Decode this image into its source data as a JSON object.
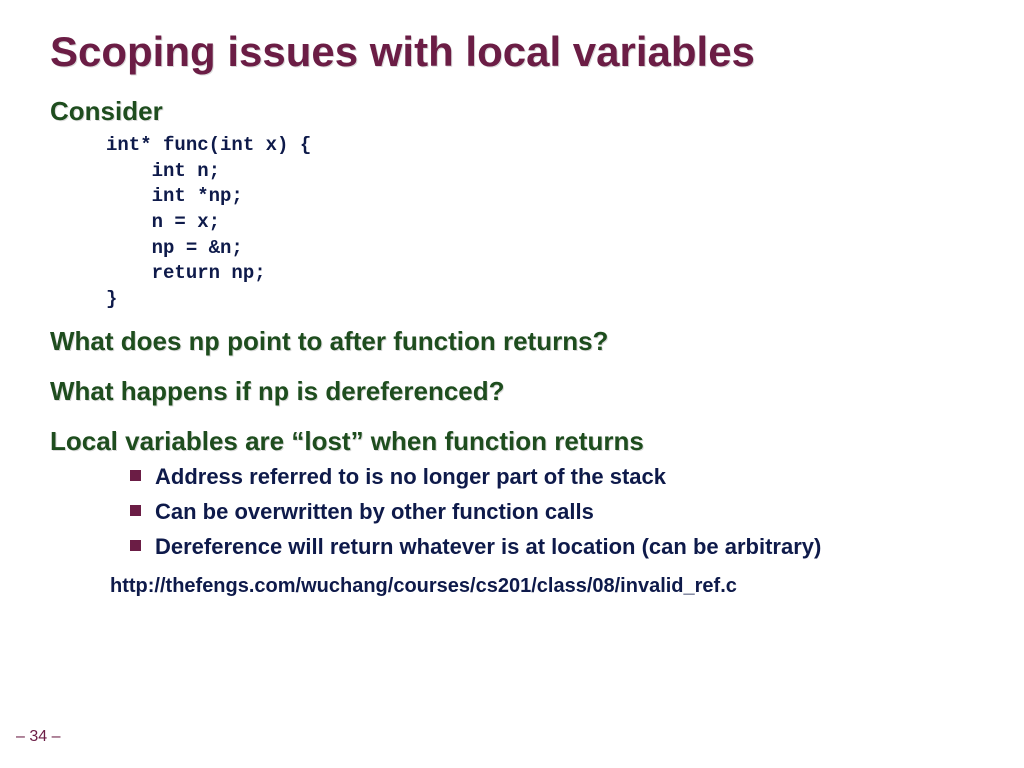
{
  "title": "Scoping issues with local variables",
  "sections": {
    "consider": "Consider",
    "q1_pre": "What does ",
    "q1_code": "np",
    "q1_post": " point to after function returns?",
    "q2_pre": "What happens if ",
    "q2_code": "np",
    "q2_post": " is dereferenced?",
    "lost": "Local variables are “lost” when function returns"
  },
  "code": "int* func(int x) {\n    int n;\n    int *np;\n    n = x;\n    np = &n;\n    return np;\n}",
  "bullets": [
    "Address referred to is no longer part of the stack",
    "Can be overwritten by other function calls",
    "Dereference will return whatever is at location (can be arbitrary)"
  ],
  "url": "http://thefengs.com/wuchang/courses/cs201/class/08/invalid_ref.c",
  "page": "– 34 –"
}
